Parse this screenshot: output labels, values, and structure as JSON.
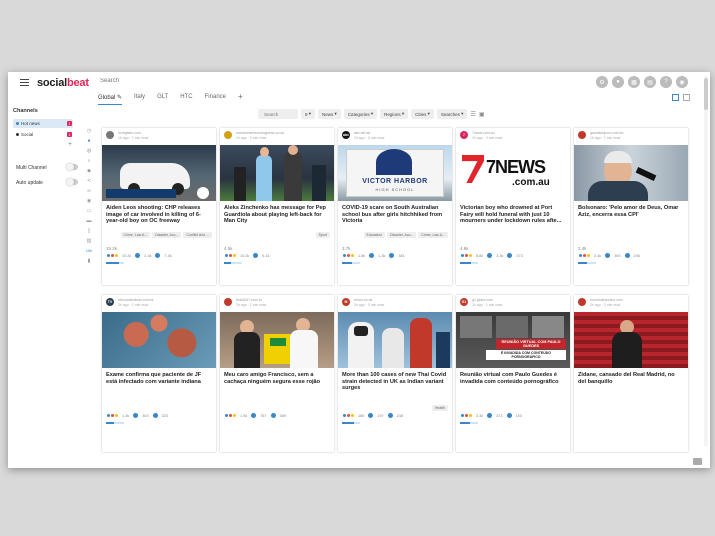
{
  "app": {
    "logo_prefix": "social",
    "logo_accent": "beat",
    "search_placeholder": "Search"
  },
  "top_icons": [
    "gear-icon",
    "bell-icon",
    "apps-icon",
    "grid-icon",
    "help-icon",
    "user-icon"
  ],
  "tabs": [
    {
      "label": "Global",
      "active": true
    },
    {
      "label": "Italy",
      "active": false
    },
    {
      "label": "GLT",
      "active": false
    },
    {
      "label": "HTC",
      "active": false
    },
    {
      "label": "Finance",
      "active": false
    }
  ],
  "tab_plus": "+",
  "filters": {
    "search_placeholder": "Search",
    "count": "9",
    "chips": [
      "News",
      "Categories",
      "Regions",
      "Cities",
      "Searches"
    ]
  },
  "sidebar": {
    "title": "Channels",
    "channels": [
      {
        "label": "Hot news",
        "badge": "1",
        "active": true
      },
      {
        "label": "Social",
        "badge": "1",
        "active": false
      }
    ],
    "add": "+",
    "multi_channel": "Multi Channel",
    "auto_update": "Auto update",
    "side_count": "10k"
  },
  "colors": {
    "accent": "#e0265c",
    "blue": "#3a86c8"
  },
  "cards": [
    {
      "title": "Aiden Leos shooting: CHP releases image of car involved in killing of 6-year-old boy on OC freeway",
      "tags": [
        "Crime, Law A...",
        "Disaster, Acc...",
        "Conflict And ..."
      ],
      "count": "15.2k",
      "stats": [
        "10.2k",
        "2.3k",
        "7.3k"
      ],
      "logo_color": "#777",
      "logo_text": ""
    },
    {
      "title": "Aleks Zinchenko has message for Pep Guardiola about playing left-back for Man City",
      "tags": [
        "Sport"
      ],
      "count": "4.5k",
      "stats": [
        "10.2k",
        "5.1k"
      ],
      "logo_color": "#d4a017",
      "logo_text": ""
    },
    {
      "title": "COVID-19 scare on South Australian school bus after girls hitchhiked from Victoria",
      "tags": [
        "Education",
        "Disaster, Acc...",
        "Crime, Law A..."
      ],
      "count": "3.7k",
      "stats": [
        "1.8k",
        "1.3k",
        "381"
      ],
      "logo_color": "#111",
      "logo_text": "abc"
    },
    {
      "title": "Victorian boy who drowned at Port Fairy will hold funeral with just 10 mourners under lockdown rules afte...",
      "tags": [],
      "count": "4.9k",
      "stats": [
        "8.8k",
        "3.3k",
        "373"
      ],
      "logo_color": "#e0265c",
      "logo_text": "7"
    },
    {
      "title": "Bolsonaro: 'Pelo amor de Deus, Omar Aziz, encerra essa CPI'",
      "tags": [],
      "count": "2.4k",
      "stats": [
        "2.4k",
        "393",
        "246"
      ],
      "logo_color": "#c0392b",
      "logo_text": ""
    },
    {
      "title": "Exame confirma que paciente de JF está infectado com variante indiana",
      "tags": [],
      "count": "",
      "stats": [
        "1.3k",
        "303",
        "323"
      ],
      "logo_color": "#2c3e50",
      "logo_text": "TV"
    },
    {
      "title": "Meu caro amigo Francisco, sem a cachaça ninguém segura esse rojão",
      "tags": [],
      "count": "",
      "stats": [
        "1.9k",
        "767",
        "389"
      ],
      "logo_color": "#c0392b",
      "logo_text": ""
    },
    {
      "title": "More than 100 cases of new Thai Covid strain detected in UK as Indian variant surges",
      "tags": [
        "Health"
      ],
      "count": "",
      "stats": [
        "186",
        "197",
        "248"
      ],
      "logo_color": "#c0392b",
      "logo_text": "M"
    },
    {
      "title": "Reunião virtual com Paulo Guedes é invadida com conteúdo pornográfico",
      "tags": [],
      "count": "",
      "stats": [
        "3.3k",
        "373",
        "153"
      ],
      "logo_color": "#c0392b",
      "logo_text": "G1"
    },
    {
      "title": "Zidane, cansado del Real Madrid, no del banquillo",
      "tags": [],
      "count": "",
      "stats": [],
      "logo_color": "#c0392b",
      "logo_text": ""
    }
  ],
  "thumb_texts": {
    "news7": "7NEWS",
    "news7_sub": ".com.au",
    "victor": "VICTOR HARBOR",
    "victor_sub": "HIGH SCHOOL",
    "reuniao": "REUNIÃO VIRTUAL COM PAULO GUEDES",
    "reuniao2": "É INVADIDA COM CONTEÚDO PORNOGRÁFICO"
  }
}
